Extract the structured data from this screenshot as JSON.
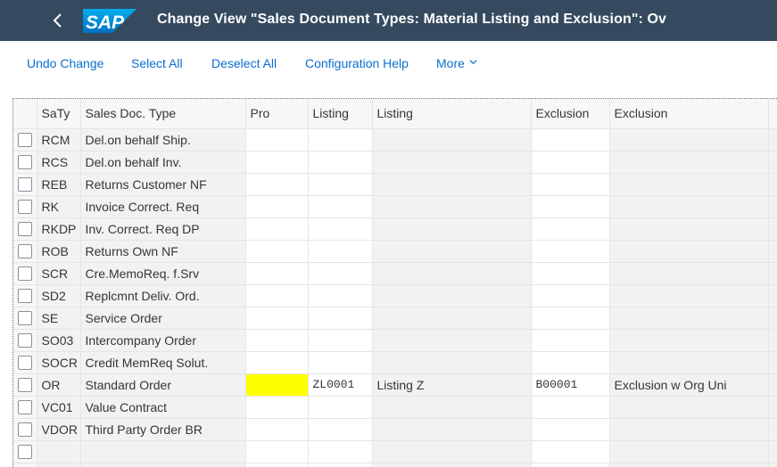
{
  "header": {
    "title": "Change View \"Sales Document Types: Material Listing and Exclusion\": Ov",
    "logo_text": "SAP",
    "back_icon": "chevron-left-icon",
    "colors": {
      "shell_bg": "#354a5f",
      "logo_blue": "#0a6ed1",
      "highlight": "#ffff00"
    }
  },
  "toolbar": {
    "undo_change": "Undo Change",
    "select_all": "Select All",
    "deselect_all": "Deselect All",
    "configuration_help": "Configuration Help",
    "more": "More",
    "more_icon": "chevron-down-icon"
  },
  "table": {
    "columns": [
      "SaTy",
      "Sales Doc. Type",
      "Pro",
      "Listing",
      "Listing",
      "Exclusion",
      "Exclusion"
    ],
    "rows": [
      {
        "saty": "RCM",
        "desc": "Del.on behalf Ship.",
        "pro": "",
        "listing": "",
        "listing_text": "",
        "exclusion": "",
        "exclusion_text": ""
      },
      {
        "saty": "RCS",
        "desc": "Del.on behalf Inv.",
        "pro": "",
        "listing": "",
        "listing_text": "",
        "exclusion": "",
        "exclusion_text": ""
      },
      {
        "saty": "REB",
        "desc": "Returns Customer NF",
        "pro": "",
        "listing": "",
        "listing_text": "",
        "exclusion": "",
        "exclusion_text": ""
      },
      {
        "saty": "RK",
        "desc": "Invoice Correct. Req",
        "pro": "",
        "listing": "",
        "listing_text": "",
        "exclusion": "",
        "exclusion_text": ""
      },
      {
        "saty": "RKDP",
        "desc": "Inv. Correct. Req DP",
        "pro": "",
        "listing": "",
        "listing_text": "",
        "exclusion": "",
        "exclusion_text": ""
      },
      {
        "saty": "ROB",
        "desc": "Returns Own NF",
        "pro": "",
        "listing": "",
        "listing_text": "",
        "exclusion": "",
        "exclusion_text": ""
      },
      {
        "saty": "SCR",
        "desc": "Cre.MemoReq. f.Srv",
        "pro": "",
        "listing": "",
        "listing_text": "",
        "exclusion": "",
        "exclusion_text": ""
      },
      {
        "saty": "SD2",
        "desc": "Replcmnt Deliv. Ord.",
        "pro": "",
        "listing": "",
        "listing_text": "",
        "exclusion": "",
        "exclusion_text": ""
      },
      {
        "saty": "SE",
        "desc": "Service Order",
        "pro": "",
        "listing": "",
        "listing_text": "",
        "exclusion": "",
        "exclusion_text": ""
      },
      {
        "saty": "SO03",
        "desc": "Intercompany Order",
        "pro": "",
        "listing": "",
        "listing_text": "",
        "exclusion": "",
        "exclusion_text": ""
      },
      {
        "saty": "SOCR",
        "desc": "Credit MemReq Solut.",
        "pro": "",
        "listing": "",
        "listing_text": "",
        "exclusion": "",
        "exclusion_text": ""
      },
      {
        "saty": "OR",
        "desc": "Standard Order",
        "pro": "",
        "listing": "ZL0001",
        "listing_text": "Listing Z",
        "exclusion": "B00001",
        "exclusion_text": "Exclusion w Org Uni",
        "pro_highlight": true
      },
      {
        "saty": "VC01",
        "desc": "Value Contract",
        "pro": "",
        "listing": "",
        "listing_text": "",
        "exclusion": "",
        "exclusion_text": ""
      },
      {
        "saty": "VDOR",
        "desc": "Third Party Order BR",
        "pro": "",
        "listing": "",
        "listing_text": "",
        "exclusion": "",
        "exclusion_text": ""
      },
      {
        "saty": "",
        "desc": "",
        "pro": "",
        "listing": "",
        "listing_text": "",
        "exclusion": "",
        "exclusion_text": ""
      },
      {
        "saty": "",
        "desc": "",
        "pro": "",
        "listing": "",
        "listing_text": "",
        "exclusion": "",
        "exclusion_text": ""
      }
    ]
  }
}
